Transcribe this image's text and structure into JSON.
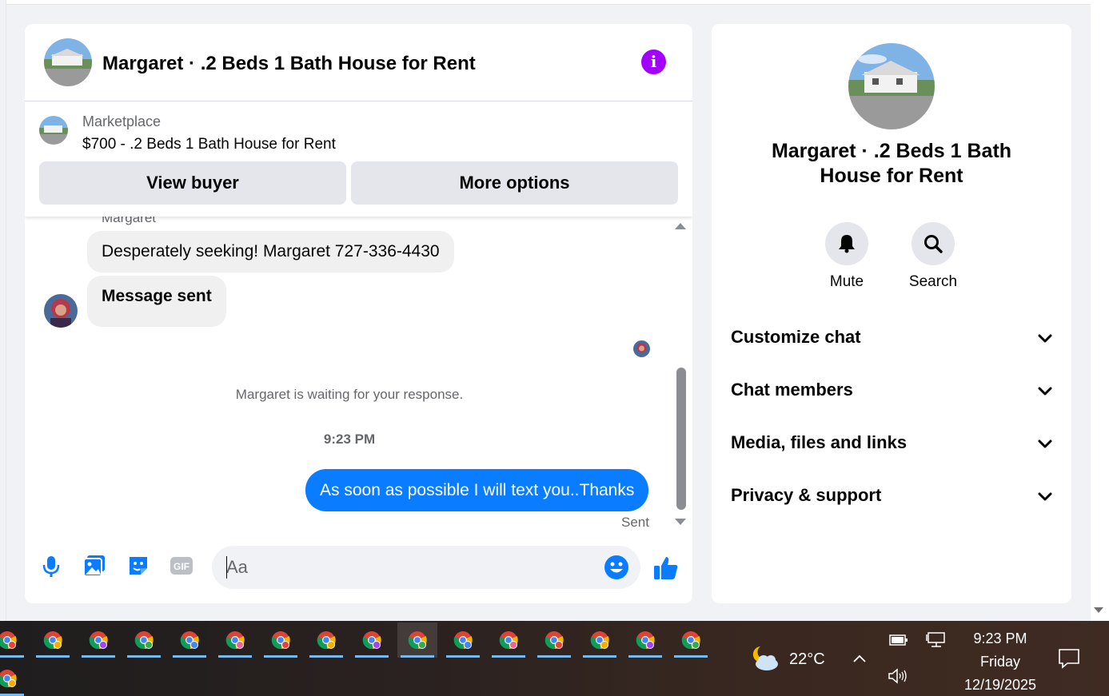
{
  "chat": {
    "title": "Margaret · .2 Beds 1 Bath House for Rent",
    "marketplace_label": "Marketplace",
    "listing": "$700 - .2 Beds 1 Bath House for Rent",
    "view_buyer": "View buyer",
    "more_options": "More options",
    "sender_name": "Margaret",
    "messages": [
      {
        "text": "Desperately seeking! Margaret 727-336-4430",
        "direction": "incoming"
      },
      {
        "text": "Message sent",
        "direction": "incoming"
      }
    ],
    "waiting_notice": "Margaret is waiting for your response.",
    "timestamp": "9:23 PM",
    "outgoing_message": "As soon as possible I will text you..Thanks",
    "outgoing_status": "Sent",
    "composer_placeholder": "Aa",
    "composer_icons": [
      "microphone-icon",
      "photo-icon",
      "sticker-icon",
      "gif-icon",
      "emoji-icon",
      "like-icon"
    ]
  },
  "info": {
    "name": "Margaret · .2 Beds 1 Bath House for Rent",
    "actions": {
      "mute": "Mute",
      "search": "Search"
    },
    "sections": [
      "Customize chat",
      "Chat members",
      "Media, files and links",
      "Privacy & support"
    ]
  },
  "taskbar": {
    "app_count": 16,
    "active_app_index": 9,
    "temperature": "22°C",
    "time": "9:23 PM",
    "day": "Friday",
    "date": "12/19/2025"
  },
  "colors": {
    "accent_blue": "#0a7cff",
    "info_purple": "#a200ff",
    "icon_blue": "#0a7cff"
  }
}
